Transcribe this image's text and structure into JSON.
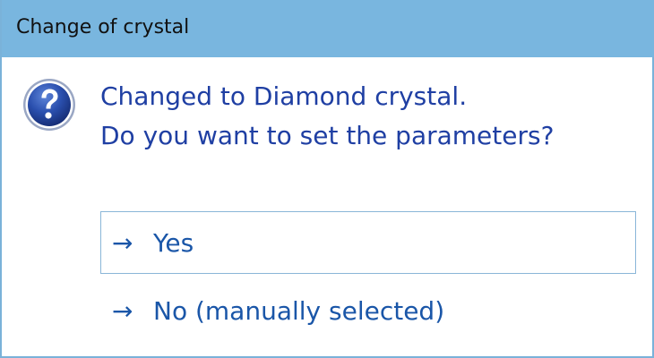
{
  "window": {
    "title": "Change of crystal"
  },
  "dialog": {
    "icon": "question-icon",
    "message_lines": [
      "Changed to Diamond crystal.",
      "Do you want to set the parameters?"
    ],
    "commands": [
      {
        "arrow": "→",
        "label": "Yes"
      },
      {
        "arrow": "→",
        "label": "No (manually selected)"
      }
    ]
  },
  "colors": {
    "titlebar": "#79b6df",
    "message_text": "#1f3fa3",
    "command_text": "#1a56a8",
    "icon_blue": "#1f3b8f"
  }
}
